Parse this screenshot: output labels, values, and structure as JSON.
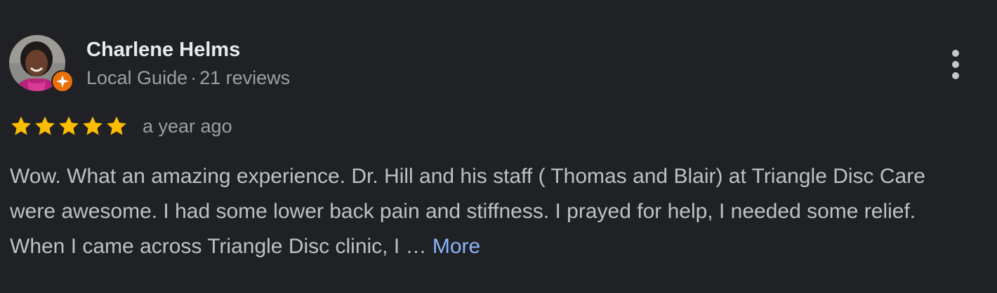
{
  "review": {
    "author_name": "Charlene Helms",
    "author_badge": "Local Guide",
    "author_separator": "·",
    "author_review_count": "21 reviews",
    "rating": 5,
    "rating_max": 5,
    "timestamp": "a year ago",
    "text": "Wow. What an amazing experience. Dr. Hill and his staff ( Thomas and Blair) at Triangle Disc Care were awesome. I had some lower back pain and stiffness. I prayed for help, I needed some relief. When I came across Triangle Disc clinic, I …",
    "more_label": "More"
  },
  "icons": {
    "badge": "local-guide-icon",
    "menu": "more-vert-icon",
    "star": "star-icon"
  },
  "colors": {
    "background": "#202124",
    "name": "#e8eaed",
    "secondary_text": "#9aa0a6",
    "body_text": "#bdc1c6",
    "link": "#8ab4f8",
    "star": "#fbbc04",
    "badge": "#e8710a"
  }
}
